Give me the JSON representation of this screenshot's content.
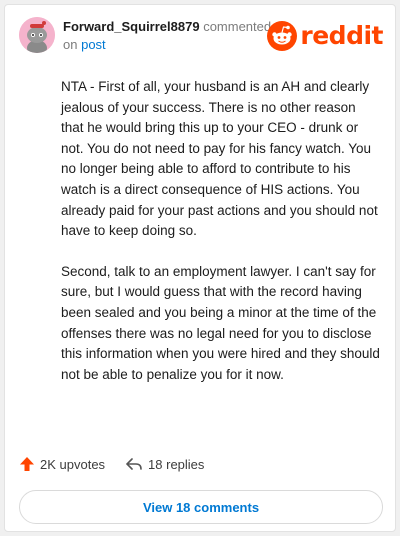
{
  "header": {
    "username": "Forward_Squirrel8879",
    "action_text": "commented",
    "on_text": "on",
    "post_link": "post",
    "logo_text": "reddit"
  },
  "comment": {
    "paragraphs": [
      "NTA - First of all, your husband is an AH and clearly jealous of your success. There is no other reason that he would bring this up to your CEO - drunk or not. You do not need to pay for his fancy watch. You no longer being able to afford to contribute to his watch is a direct consequence of HIS actions. You already paid for your past actions and you should not have to keep doing so.",
      "Second, talk to an employment lawyer. I can't say for sure, but I would guess that with the record having been sealed and you being a minor at the time of the offenses there was no legal need for you to disclose this information when you were hired and they should not be able to penalize you for it now."
    ]
  },
  "footer": {
    "upvotes": "2K upvotes",
    "replies": "18 replies",
    "view_comments": "View 18 comments"
  },
  "colors": {
    "brand": "#ff4500",
    "link": "#0079d3",
    "avatar_bg": "#f5b3cc"
  },
  "icons": [
    "avatar-icon",
    "reddit-logo-icon",
    "upvote-arrow-icon",
    "reply-arrow-icon"
  ]
}
